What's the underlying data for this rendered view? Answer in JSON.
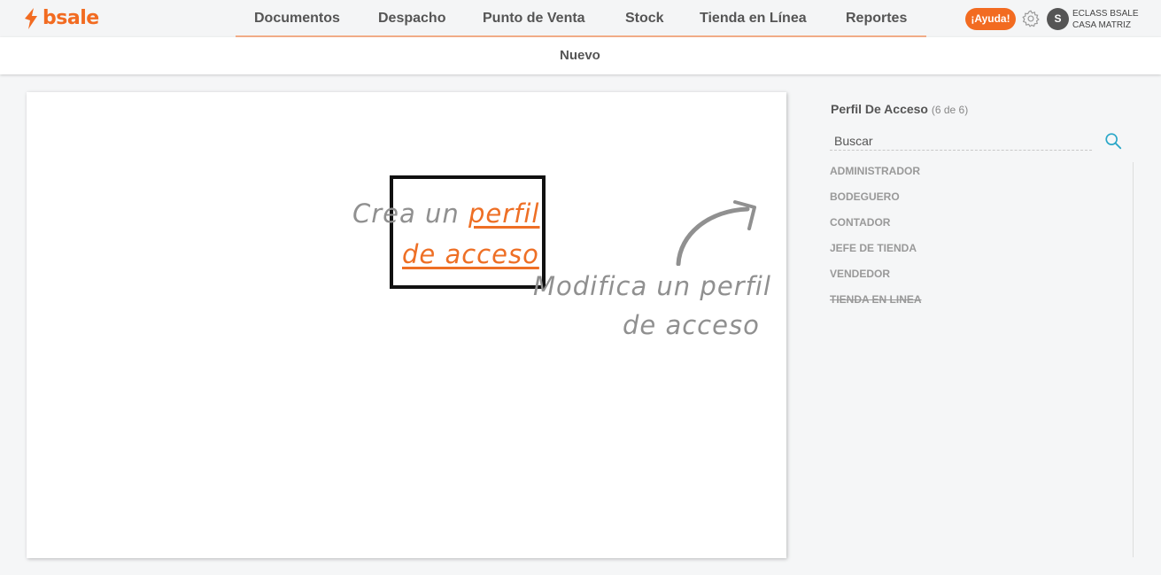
{
  "brand": {
    "name": "bsale",
    "color": "#f26b21"
  },
  "nav": {
    "items": [
      "Documentos",
      "Despacho",
      "Punto de Venta",
      "Stock",
      "Tienda en Línea",
      "Reportes"
    ]
  },
  "header": {
    "help_label": "¡Ayuda!",
    "avatar_initial": "S",
    "company_line1": "ECLASS BSALE",
    "company_line2": "CASA MATRIZ"
  },
  "subnav": {
    "new_label": "Nuevo"
  },
  "hints": {
    "create_prefix": "Crea un",
    "create_link_line1": "perfil",
    "create_link_line2": "de acceso",
    "modify_line1": "Modifica un perfil",
    "modify_line2": "de acceso"
  },
  "sidebar": {
    "title": "Perfil De Acceso",
    "count": "(6 de 6)",
    "search_placeholder": "Buscar",
    "profiles": [
      {
        "label": "ADMINISTRADOR",
        "disabled": false
      },
      {
        "label": "BODEGUERO",
        "disabled": false
      },
      {
        "label": "CONTADOR",
        "disabled": false
      },
      {
        "label": "JEFE DE TIENDA",
        "disabled": false
      },
      {
        "label": "VENDEDOR",
        "disabled": false
      },
      {
        "label": "TIENDA EN LINEA",
        "disabled": true
      }
    ]
  },
  "icons": {
    "gear": "gear-icon",
    "search": "search-icon",
    "arrow": "curved-arrow-icon"
  },
  "colors": {
    "accent": "#f26b21",
    "hint_gray": "#909090",
    "search_icon": "#2aa7c8"
  }
}
